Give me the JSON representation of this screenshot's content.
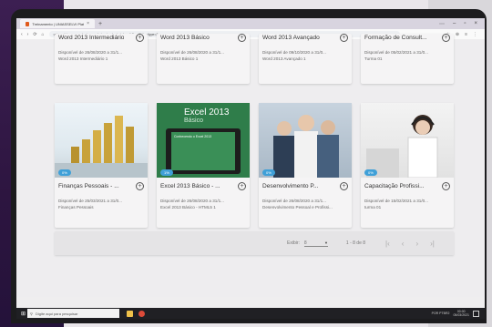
{
  "browser": {
    "tab_title": "Treinamento | UNIASSELVI Platform",
    "tab_close": "×",
    "new_tab": "+",
    "window_controls": [
      "⋯",
      "–",
      "▫",
      "×"
    ],
    "nav_icons": [
      "‹",
      "›",
      "⟳",
      "⌂"
    ],
    "url": "uniasselvi.cursoscadastro.com.br/conteudos/catalogo/trilhas/listing/type=3",
    "addr_right_icons": [
      "☆",
      "⊕",
      "≡",
      "⋮"
    ]
  },
  "top_cards": [
    {
      "title": "Word 2013 Intermediário",
      "line1": "Disponível de 26/08/2020 a 31/1...",
      "line2": "Word 2013 Intermediário 1"
    },
    {
      "title": "Word 2013 Básico",
      "line1": "Disponível de 26/08/2020 a 31/1...",
      "line2": "Word 2013 Básico 1"
    },
    {
      "title": "Word 2013 Avançado",
      "line1": "Disponível de 09/10/2020 a 31/0...",
      "line2": "Word 2013 Avançado 1"
    },
    {
      "title": "Formação de Consult...",
      "line1": "Disponível de 05/02/2021 a 31/0...",
      "line2": "Turma 01"
    }
  ],
  "cards": [
    {
      "title": "Finanças Pessoais - ...",
      "badge": "0%",
      "line1": "Disponível de 25/03/2021 a 31/0...",
      "line2": "Finanças Pessoais"
    },
    {
      "title": "Excel 2013 Básico - ...",
      "badge": "1%",
      "line1": "Disponível de 26/08/2020 a 31/1...",
      "line2": "Excel 2013 Básico - HTML5 1",
      "thumb_title": "Excel 2013",
      "thumb_subtitle": "Básico",
      "thumb_panel": "Conhecendo o Excel 2013"
    },
    {
      "title": "Desenvolvimento P...",
      "badge": "0%",
      "line1": "Disponível de 26/08/2020 a 31/1...",
      "line2": "Desenvolvimento Pessoal e Profissi..."
    },
    {
      "title": "Capacitação Profissi...",
      "badge": "0%",
      "line1": "Disponível de 15/02/2021 a 31/0...",
      "line2": "turma 01"
    }
  ],
  "pager": {
    "label": "Exibir:",
    "page_size": "8",
    "dropdown_arrow": "▼",
    "range": "1 - 8 de 8",
    "nav": [
      "|‹",
      "‹",
      "›",
      "›|"
    ]
  },
  "taskbar": {
    "start": "⊞",
    "search_icon": "⚲",
    "search_placeholder": "Digite aqui para pesquisar",
    "tray_text": "POR PTBR2",
    "time": "00:00",
    "date": "05/03/2021"
  },
  "colors": {
    "badge": "#3fa0d8",
    "excel_green": "#2f7d4a",
    "purple_bg": "#3c1f52"
  }
}
